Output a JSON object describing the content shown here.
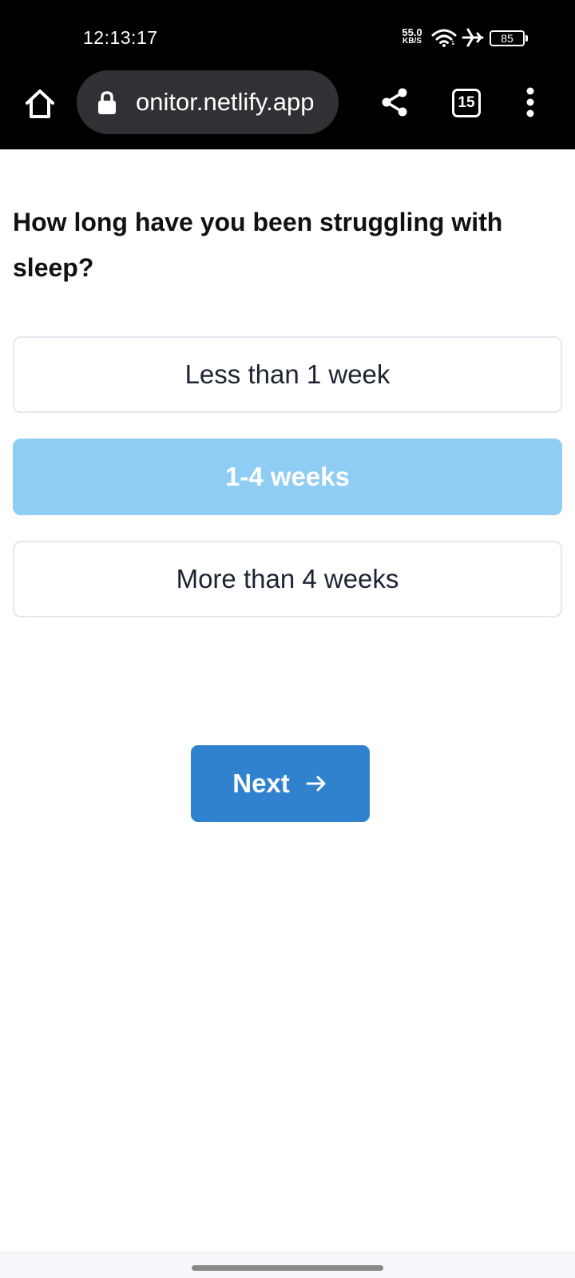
{
  "status_bar": {
    "time": "12:13:17",
    "net_speed_value": "55.0",
    "net_speed_unit": "KB/S",
    "battery": "85"
  },
  "browser": {
    "url": "onitor.netlify.app",
    "tab_count": "15"
  },
  "survey": {
    "question": "How long have you been struggling with sleep?",
    "options": [
      {
        "label": "Less than 1 week",
        "selected": false
      },
      {
        "label": "1-4 weeks",
        "selected": true
      },
      {
        "label": "More than 4 weeks",
        "selected": false
      }
    ],
    "next_label": "Next"
  },
  "icons": {
    "home": "home-icon",
    "lock": "lock-icon",
    "share": "share-icon",
    "menu": "more-vert-icon",
    "arrow": "arrow-right-icon",
    "wifi": "wifi-icon",
    "airplane": "airplane-icon"
  },
  "colors": {
    "selected_option": "#90cdf4",
    "primary_button": "#3182ce",
    "option_border": "#e4e8ee"
  }
}
